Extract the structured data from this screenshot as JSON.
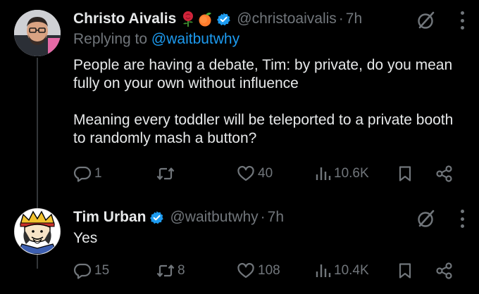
{
  "tweets": [
    {
      "name": "Christo Aivalis",
      "name_emoji": [
        "rose",
        "peach"
      ],
      "verified": true,
      "handle": "@christoaivalis",
      "separator": "·",
      "time": "7h",
      "replying_prefix": "Replying to",
      "replying_mention": "@waitbutwhy",
      "text": "People are having a debate, Tim: by private, do you mean fully on your own without influence\n\nMeaning every toddler will be teleported to a private booth to randomly mash a button?",
      "counts": {
        "replies": "1",
        "retweets": "",
        "likes": "40",
        "views": "10.6K"
      }
    },
    {
      "name": "Tim Urban",
      "verified": true,
      "handle": "@waitbutwhy",
      "separator": "·",
      "time": "7h",
      "text": "Yes",
      "counts": {
        "replies": "15",
        "retweets": "8",
        "likes": "108",
        "views": "10.4K"
      }
    }
  ],
  "colors": {
    "background": "#000000",
    "text": "#e7e9ea",
    "muted": "#71767b",
    "accent": "#1d9bf0",
    "thread_line": "#333639"
  },
  "icons": [
    "verified-badge-icon",
    "rose-icon",
    "peach-icon",
    "grok-icon",
    "more-icon",
    "reply-icon",
    "retweet-icon",
    "like-icon",
    "views-icon",
    "bookmark-icon",
    "share-icon"
  ]
}
